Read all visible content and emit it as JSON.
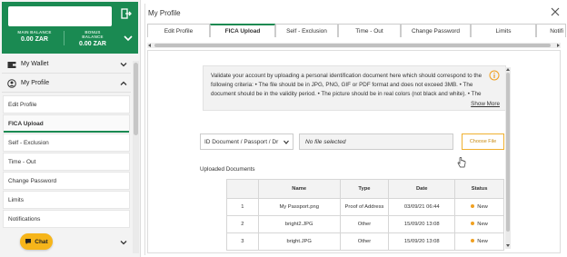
{
  "sidebar": {
    "main_balance_label": "MAIN BALANCE",
    "main_balance_value": "0.00 ZAR",
    "bonus_balance_label": "BONUS BALANCE",
    "bonus_balance_value": "0.00 ZAR",
    "wallet_label": "My Wallet",
    "profile_label": "My Profile",
    "items": [
      {
        "label": "Edit Profile"
      },
      {
        "label": "FICA Upload"
      },
      {
        "label": "Self - Exclusion"
      },
      {
        "label": "Time - Out"
      },
      {
        "label": "Change Password"
      },
      {
        "label": "Limits"
      },
      {
        "label": "Notifications"
      }
    ],
    "chat_label": "Chat"
  },
  "modal": {
    "title": "My Profile",
    "tabs": [
      {
        "label": "Edit Profile"
      },
      {
        "label": "FICA Upload"
      },
      {
        "label": "Self - Exclusion"
      },
      {
        "label": "Time - Out"
      },
      {
        "label": "Change Password"
      },
      {
        "label": "Limits"
      },
      {
        "label": "Notifi"
      }
    ],
    "info_text": "Validate your account by uploading a personal identification document here which should correspond to the following criteria: • The file should be in JPG, PNG, GIF or PDF format and does not exceed 3MB. • The document should be in the validity period. • The picture should be in real colors (not black and white). • The",
    "show_more": "Show More",
    "doc_type_selected": "ID Document / Passport / Dr",
    "file_field": "No file selected",
    "choose_file": "Choose File",
    "uploaded_label": "Uploaded Documents",
    "table": {
      "headers": [
        "",
        "Name",
        "Type",
        "Date",
        "Status"
      ],
      "rows": [
        {
          "num": "1",
          "name": "My Passport.png",
          "type": "Proof of Address",
          "date": "03/09/21 06:44",
          "status": "New"
        },
        {
          "num": "2",
          "name": "bright2.JPG",
          "type": "Other",
          "date": "15/09/20 13:08",
          "status": "New"
        },
        {
          "num": "3",
          "name": "bright.JPG",
          "type": "Other",
          "date": "15/09/20 13:08",
          "status": "New"
        }
      ]
    }
  },
  "colors": {
    "brand_green": "#1a8a52",
    "accent_orange": "#f6b51a"
  }
}
